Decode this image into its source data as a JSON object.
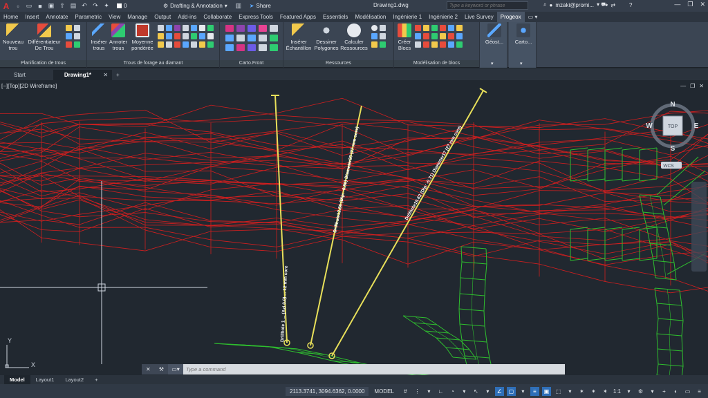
{
  "title_bar": {
    "workspace": "Drafting & Annotation",
    "layer_value": "0",
    "share_label": "Share",
    "document_title": "Drawing1.dwg",
    "search_placeholder": "Type a keyword or phrase",
    "user_name": "mzaki@promi..."
  },
  "ribbon_tabs": [
    "Home",
    "Insert",
    "Annotate",
    "Parametric",
    "View",
    "Manage",
    "Output",
    "Add-ins",
    "Collaborate",
    "Express Tools",
    "Featured Apps",
    "Essentiels",
    "Modélisation",
    "Ingénierie 1",
    "Ingénierie 2",
    "Live Survey",
    "Progeox"
  ],
  "active_ribbon_tab": "Progeox",
  "ribbon": {
    "groups": {
      "planification": "Planification de trous",
      "trous_forage": "Trous de forage au diamant",
      "carto_front": "Carto.Front",
      "ressources": "Ressources",
      "modelisation_blocs": "Modélisation de blocs"
    },
    "buttons": {
      "nouveau_trou": "Nouveau trou",
      "differentiateur": "Différentiateur De Trou",
      "inserer_trous": "Insérer trous",
      "annoter_trous": "Annoter trous",
      "moyenne_ponderee": "Moyenne pondérée",
      "inserer_echantillon": "Insérer Échantillon",
      "dessiner_polygones": "Dessiner Polygones",
      "calculer_ressources": "Calculer Ressources",
      "creer_blocs": "Créer Blocs",
      "geost": "Géost...",
      "carto": "Carto..."
    }
  },
  "file_tabs": [
    {
      "label": "Start"
    },
    {
      "label": "Drawing1*"
    }
  ],
  "viewport": {
    "view_label": "[−][Top][2D Wireframe]",
    "viewcube": {
      "north": "N",
      "south": "S",
      "east": "E",
      "west": "W",
      "face": "TOP",
      "wcs": "WCS"
    },
    "ucs": {
      "x": "X",
      "y": "Y"
    },
    "drillhole_labels": [
      "Drillhole 1 ... (Azi 0.0) ... 12 mm core",
      "Drillhole12.56 (Dip: -0.88) Diameter20 (27 mm core)",
      "Drillhole19.63 (Dip: -0.71) Diameter17 (27 mm core)"
    ]
  },
  "command_line": {
    "placeholder": "Type a command"
  },
  "layout_tabs": [
    "Model",
    "Layout1",
    "Layout2"
  ],
  "status_bar": {
    "coordinates": "2113.3741, 3094.6362, 0.0000",
    "model_label": "MODEL",
    "scale": "1:1"
  },
  "colors": {
    "background": "#212830",
    "section_lines": "#d11f1f",
    "wireframe": "#2fbf2f",
    "drillholes": "#e8e05a"
  }
}
